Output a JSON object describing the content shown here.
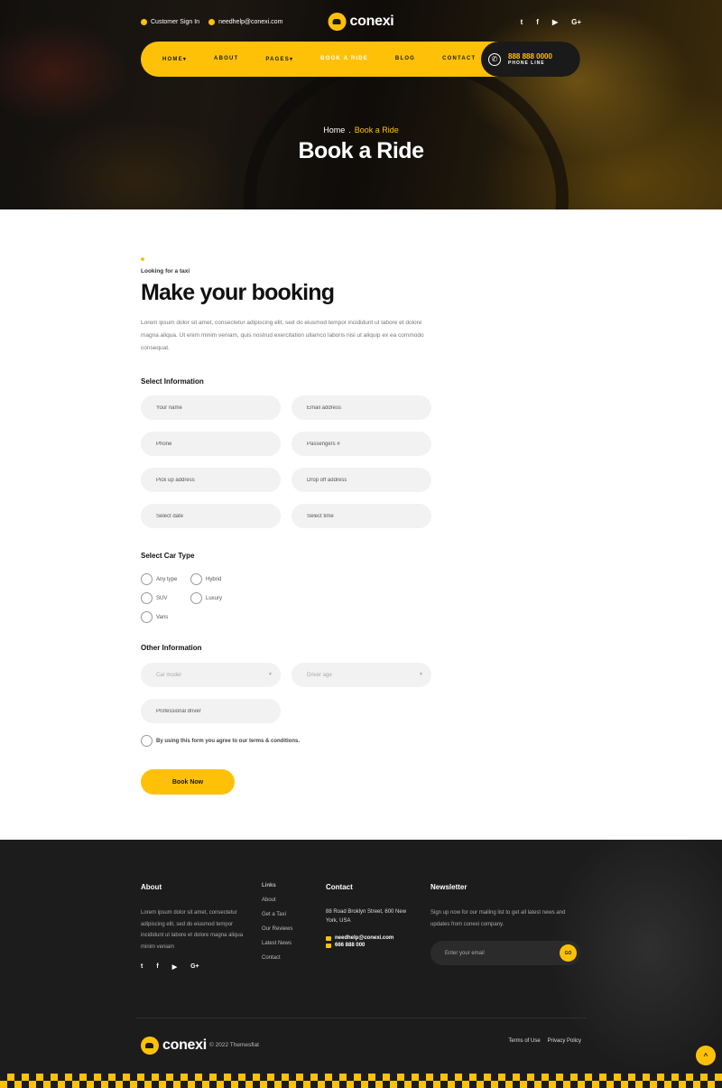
{
  "topbar": {
    "sign_in": "Customer Sign In",
    "email": "needhelp@conexi.com",
    "brand": "conexi",
    "social_icons": [
      "twitter-icon",
      "facebook-icon",
      "youtube-icon",
      "google-plus-icon"
    ],
    "social_glyphs": [
      "t",
      "f",
      "▶",
      "G+"
    ]
  },
  "nav": {
    "items": [
      "HOME",
      "ABOUT",
      "PAGES",
      "BOOK A RIDE",
      "BLOG",
      "CONTACT"
    ],
    "phone_number": "888 888 0000",
    "phone_label": "PHONE LINE"
  },
  "hero": {
    "breadcrumb_home": "Home",
    "breadcrumb_sep": ".",
    "breadcrumb_current": "Book a Ride",
    "title": "Book a Ride"
  },
  "booking": {
    "eyebrow": "Looking for a taxi",
    "heading": "Make your booking",
    "intro": "Lorem ipsum dolor sit amet, consectetur adipiscing elit, sed do eiusmod tempor incididunt ut labore et dolore magna aliqua. Ut enim minim veniam, quis nostrud exercitation ullamco laboris nisi ut aliquip ex ea commodo consequat.",
    "select_info_label": "Select Information",
    "fields": [
      "Your name",
      "Email address",
      "Phone",
      "Passengers #",
      "Pick up address",
      "Drop off address",
      "Select date",
      "Select time"
    ],
    "car_type_label": "Select Car Type",
    "car_types": [
      "Any type",
      "Hybrid",
      "SUV",
      "Luxury",
      "Vans"
    ],
    "other_info_label": "Other Information",
    "car_model": "Car model",
    "driver_age": "Driver age",
    "professional_driver": "Professional driver",
    "terms": "By using this form you agree to our terms & conditions.",
    "submit": "Book Now"
  },
  "footer": {
    "about_heading": "About",
    "about_text": "Lorem ipsum dolor sit amet, consectetur adipiscing elit, sed do eiusmod tempor incididunt ut labore et dolore magna aliqua minim veniam",
    "links_heading": "Links",
    "links": [
      "About",
      "Get a Taxi",
      "Our Reviews",
      "Latest News",
      "Contact"
    ],
    "contact_heading": "Contact",
    "address": "88 Road Broklyn Street, 600 New York, USA",
    "email": "needhelp@conexi.com",
    "phone": "666 888 000",
    "newsletter_heading": "Newsletter",
    "newsletter_text": "Sign up now for our mailing list to get all latest news and updates from conexi company.",
    "newsletter_placeholder": "Enter your email",
    "go": "GO",
    "brand": "conexi",
    "copyright": "© 2022 Themesflat",
    "terms": "Terms of Use",
    "privacy": "Privacy Policy"
  },
  "colors": {
    "accent": "#ffc107",
    "dark": "#1a1a1a",
    "footer_bg": "#1c1c1c"
  }
}
